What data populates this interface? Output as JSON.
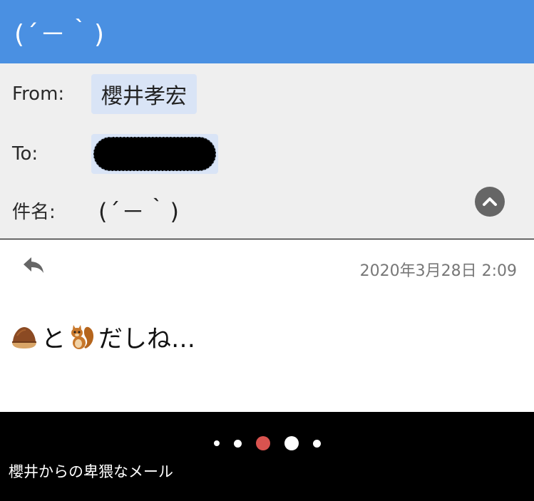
{
  "app": {
    "title": "(´－｀)"
  },
  "header": {
    "from_label": "From:",
    "from_value": "櫻井孝宏",
    "to_label": "To:",
    "subject_label": "件名:",
    "subject_value": "(´－｀)"
  },
  "message": {
    "date": "2020年3月28日 2:09",
    "text_between": "と",
    "text_after": "だしね…",
    "emoji_1": "chestnut-icon",
    "emoji_2": "squirrel-icon"
  },
  "gallery": {
    "caption": "櫻井からの卑猥なメール",
    "page_count": 5,
    "active_index": 2,
    "colors": {
      "active_dot": "#d9534f",
      "inactive_dot": "#ffffff"
    }
  },
  "colors": {
    "titlebar": "#4a90e2",
    "header_bg": "#efefef",
    "chip_bg": "#d9e4f6"
  }
}
